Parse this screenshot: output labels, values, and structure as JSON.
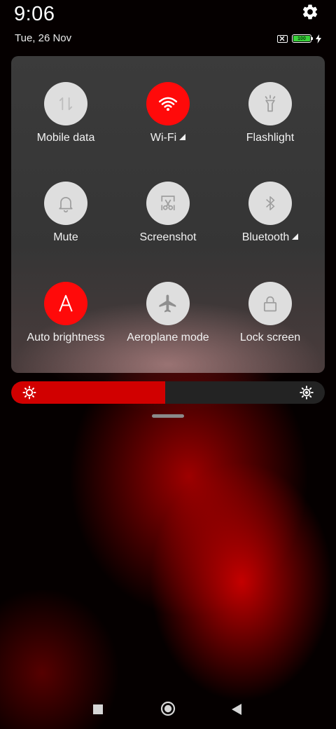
{
  "status_bar": {
    "time": "9:06",
    "date": "Tue, 26 Nov",
    "battery_level": "100",
    "icons": [
      "settings-gear-icon",
      "no-sim-icon",
      "battery-icon",
      "charging-bolt-icon"
    ]
  },
  "tiles": [
    {
      "label": "Mobile data",
      "icon": "mobile-data-arrows-icon",
      "active": false
    },
    {
      "label": "Wi-Fi",
      "icon": "wifi-icon",
      "active": true,
      "expandable": true
    },
    {
      "label": "Flashlight",
      "icon": "flashlight-icon",
      "active": false
    },
    {
      "label": "Mute",
      "icon": "bell-icon",
      "active": false
    },
    {
      "label": "Screenshot",
      "icon": "scissors-screenshot-icon",
      "active": false
    },
    {
      "label": "Bluetooth",
      "icon": "bluetooth-icon",
      "active": false,
      "expandable": true
    },
    {
      "label": "Auto brightness",
      "icon": "letter-a-icon",
      "active": true
    },
    {
      "label": "Aeroplane mode",
      "icon": "airplane-icon",
      "active": false
    },
    {
      "label": "Lock screen",
      "icon": "lock-icon",
      "active": false
    }
  ],
  "brightness": {
    "level": 0.49,
    "fill_color": "#d10000"
  },
  "colors": {
    "active_tile": "#ff0a0a",
    "inactive_tile": "#dedede",
    "panel": "#3b3b3b"
  },
  "nav_bar": {
    "icons": [
      "recents-square-icon",
      "home-circle-icon",
      "back-triangle-icon"
    ]
  }
}
